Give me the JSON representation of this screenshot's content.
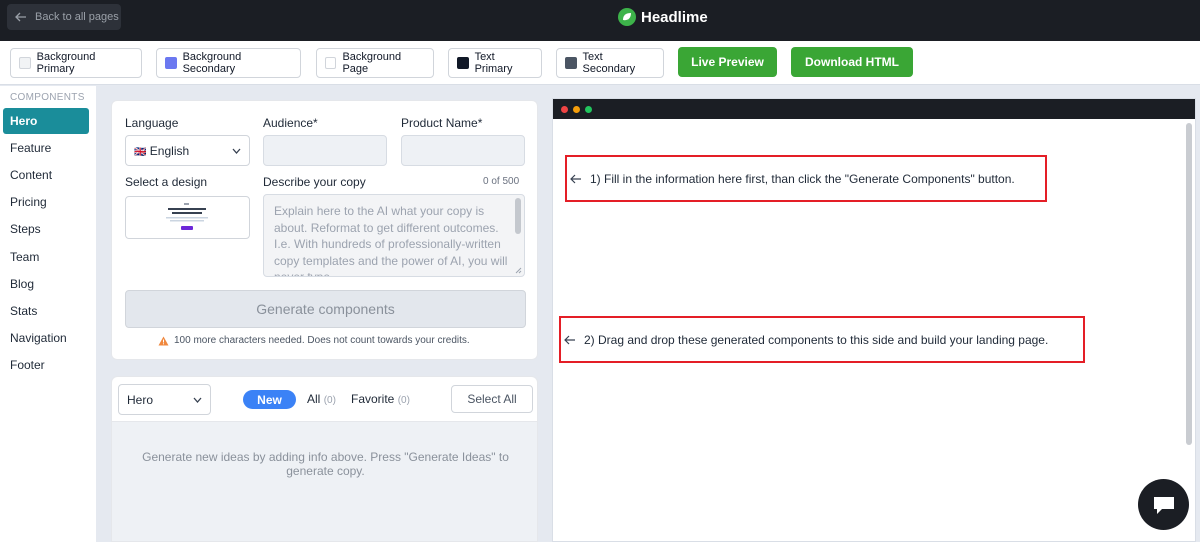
{
  "topbar": {
    "back_label": "Back to all pages",
    "brand_name": "Headlime"
  },
  "toolbar": {
    "buttons": [
      {
        "label": "Background Primary",
        "swatch": "#f1f3f5"
      },
      {
        "label": "Background Secondary",
        "swatch": "#6b78f0"
      },
      {
        "label": "Background Page",
        "swatch": "#ffffff"
      },
      {
        "label": "Text Primary",
        "swatch": "#111827"
      },
      {
        "label": "Text Secondary",
        "swatch": "#4b5563"
      }
    ],
    "live_preview": "Live Preview",
    "download_html": "Download HTML"
  },
  "sidebar": {
    "heading": "COMPONENTS",
    "items": [
      {
        "label": "Hero",
        "active": true
      },
      {
        "label": "Feature"
      },
      {
        "label": "Content"
      },
      {
        "label": "Pricing"
      },
      {
        "label": "Steps"
      },
      {
        "label": "Team"
      },
      {
        "label": "Blog"
      },
      {
        "label": "Stats"
      },
      {
        "label": "Navigation"
      },
      {
        "label": "Footer"
      }
    ]
  },
  "form": {
    "language_label": "Language",
    "language_value": "English",
    "language_flag": "🇬🇧",
    "audience_label": "Audience*",
    "product_label": "Product Name*",
    "design_label": "Select a design",
    "copy_label": "Describe your copy",
    "copy_count": "0 of 500",
    "copy_placeholder": "Explain here to the AI what your copy is about. Reformat to get different outcomes. I.e. With hundreds of professionally-written copy templates and the power of AI, you will never type",
    "generate_label": "Generate components",
    "warning": "100 more characters needed. Does not count towards your credits."
  },
  "ideas": {
    "select_value": "Hero",
    "new_label": "New",
    "all_label": "All",
    "all_count": "(0)",
    "favorite_label": "Favorite",
    "favorite_count": "(0)",
    "select_all": "Select All",
    "empty_message": "Generate new ideas by adding info above. Press \"Generate Ideas\" to generate copy."
  },
  "preview": {
    "hint_1": "1) Fill in the information here first, than click the \"Generate Components\" button.",
    "hint_2": "2) Drag and drop these generated components to this side and build your landing page."
  },
  "colors": {
    "brand_green": "#3aa635",
    "active_teal": "#1a8d9a",
    "hint_red": "#e41e26"
  }
}
